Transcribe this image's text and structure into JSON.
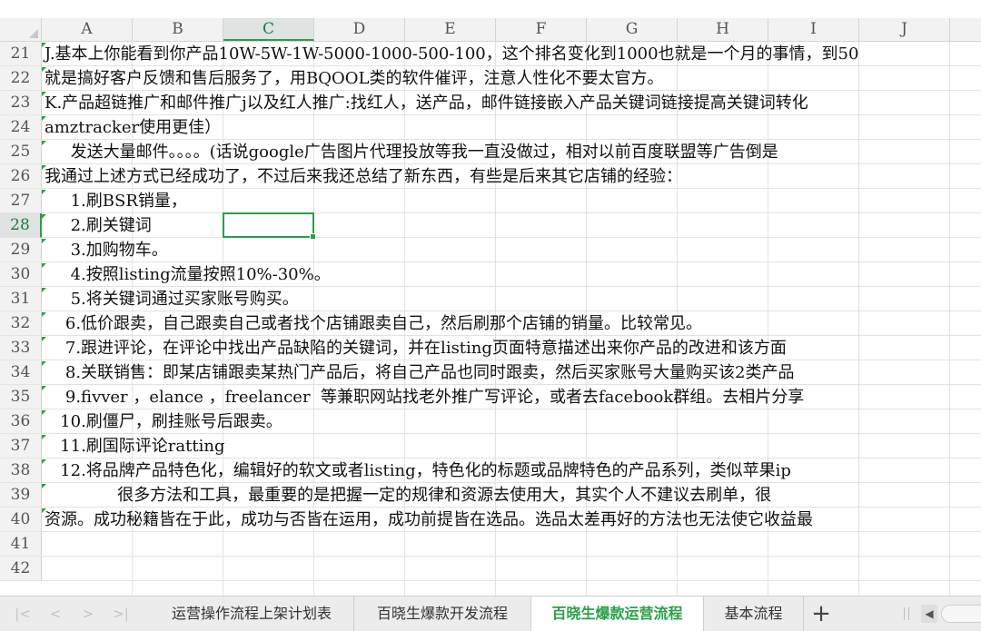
{
  "columns": [
    "A",
    "B",
    "C",
    "D",
    "E",
    "F",
    "G",
    "H",
    "I",
    "J"
  ],
  "active_column": "C",
  "active_row": "28",
  "rows": [
    {
      "num": "21",
      "text": "J.基本上你能看到你产品10W-5W-1W-5000-1000-500-100，这个排名变化到1000也就是一个月的事情，到50"
    },
    {
      "num": "22",
      "text": "就是搞好客户反馈和售后服务了，用BQOOL类的软件催评，注意人性化不要太官方。"
    },
    {
      "num": "23",
      "text": "K.产品超链推广和邮件推广j以及红人推广:找红人，送产品，邮件链接嵌入产品关键词链接提高关键词转化"
    },
    {
      "num": "24",
      "text": "amztracker使用更佳）"
    },
    {
      "num": "25",
      "text": "     发送大量邮件。。。。(话说google广告图片代理投放等我一直没做过，相对以前百度联盟等广告倒是"
    },
    {
      "num": "26",
      "text": "我通过上述方式已经成功了，不过后来我还总结了新东西，有些是后来其它店铺的经验："
    },
    {
      "num": "27",
      "text": "     1.刷BSR销量，"
    },
    {
      "num": "28",
      "text": "     2.刷关键词"
    },
    {
      "num": "29",
      "text": "     3.加购物车。"
    },
    {
      "num": "30",
      "text": "     4.按照listing流量按照10%-30%。"
    },
    {
      "num": "31",
      "text": "     5.将关键词通过买家账号购买。"
    },
    {
      "num": "32",
      "text": "    6.低价跟卖，自己跟卖自己或者找个店铺跟卖自己，然后刷那个店铺的销量。比较常见。"
    },
    {
      "num": "33",
      "text": "    7.跟进评论，在评论中找出产品缺陷的关键词，并在listing页面特意描述出来你产品的改进和该方面"
    },
    {
      "num": "34",
      "text": "    8.关联销售：即某店铺跟卖某热门产品后，将自己产品也同时跟卖，然后买家账号大量购买该2类产品"
    },
    {
      "num": "35",
      "text": "    9.fivver ，elance ，freelancer  等兼职网站找老外推广写评论，或者去facebook群组。去相片分享"
    },
    {
      "num": "36",
      "text": "   10.刷僵尸，刷挂账号后跟卖。"
    },
    {
      "num": "37",
      "text": "   11.刷国际评论ratting"
    },
    {
      "num": "38",
      "text": "   12.将品牌产品特色化，编辑好的软文或者listing，特色化的标题或品牌特色的产品系列，类似苹果ip"
    },
    {
      "num": "39",
      "text": "              很多方法和工具，最重要的是把握一定的规律和资源去使用大，其实个人不建议去刷单，很"
    },
    {
      "num": "40",
      "text": "资源。成功秘籍皆在于此，成功与否皆在运用，成功前提皆在选品。选品太差再好的方法也无法使它收益最"
    },
    {
      "num": "41",
      "text": ""
    },
    {
      "num": "42",
      "text": ""
    }
  ],
  "sheet_tabs": [
    {
      "label": "运营操作流程上架计划表",
      "active": false
    },
    {
      "label": "百晓生爆款开发流程",
      "active": false
    },
    {
      "label": "百晓生爆款运营流程",
      "active": true
    },
    {
      "label": "基本流程",
      "active": false
    }
  ],
  "tab_nav": {
    "first": "|<",
    "prev": "<",
    "next": ">",
    "last": ">|",
    "add": "+"
  },
  "colors": {
    "accent": "#2a9f4a",
    "header_bg": "#f2f2f2",
    "grid": "#e2e2e2"
  }
}
